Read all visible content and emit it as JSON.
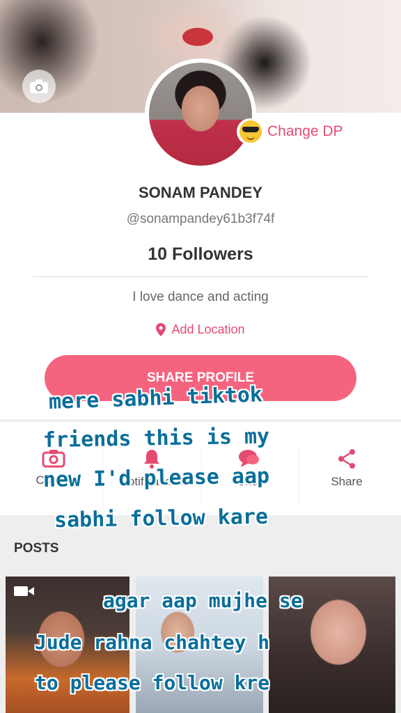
{
  "profile": {
    "change_dp_label": "Change DP",
    "name": "SONAM PANDEY",
    "handle": "@sonampandey61b3f74f",
    "followers": "10 Followers",
    "bio": "I love dance and acting",
    "add_location_label": "Add Location",
    "share_profile_label": "SHARE PROFILE"
  },
  "actions": {
    "create": "Create",
    "notifications": "Notifications",
    "chat": "Chat",
    "share": "Share"
  },
  "posts": {
    "title": "POSTS"
  },
  "overlay_text": {
    "line1": "mere sabhi tiktok",
    "line2": "friends this is my",
    "line3": "new I'd please aap",
    "line4": "sabhi follow kare",
    "line5": "agar aap mujhe se",
    "line6": "Jude rahna chahtey h",
    "line7": "to please follow kre"
  },
  "colors": {
    "accent": "#e44b73",
    "share_button": "#f5647f",
    "overlay_text": "#0a6e9a"
  },
  "icons": {
    "camera": "camera-icon",
    "change_dp": "sunglasses-emoji-icon",
    "location": "location-pin-icon",
    "create": "camera-icon",
    "notifications": "bell-icon",
    "chat": "chat-bubble-icon",
    "share": "share-icon",
    "video": "video-icon"
  }
}
